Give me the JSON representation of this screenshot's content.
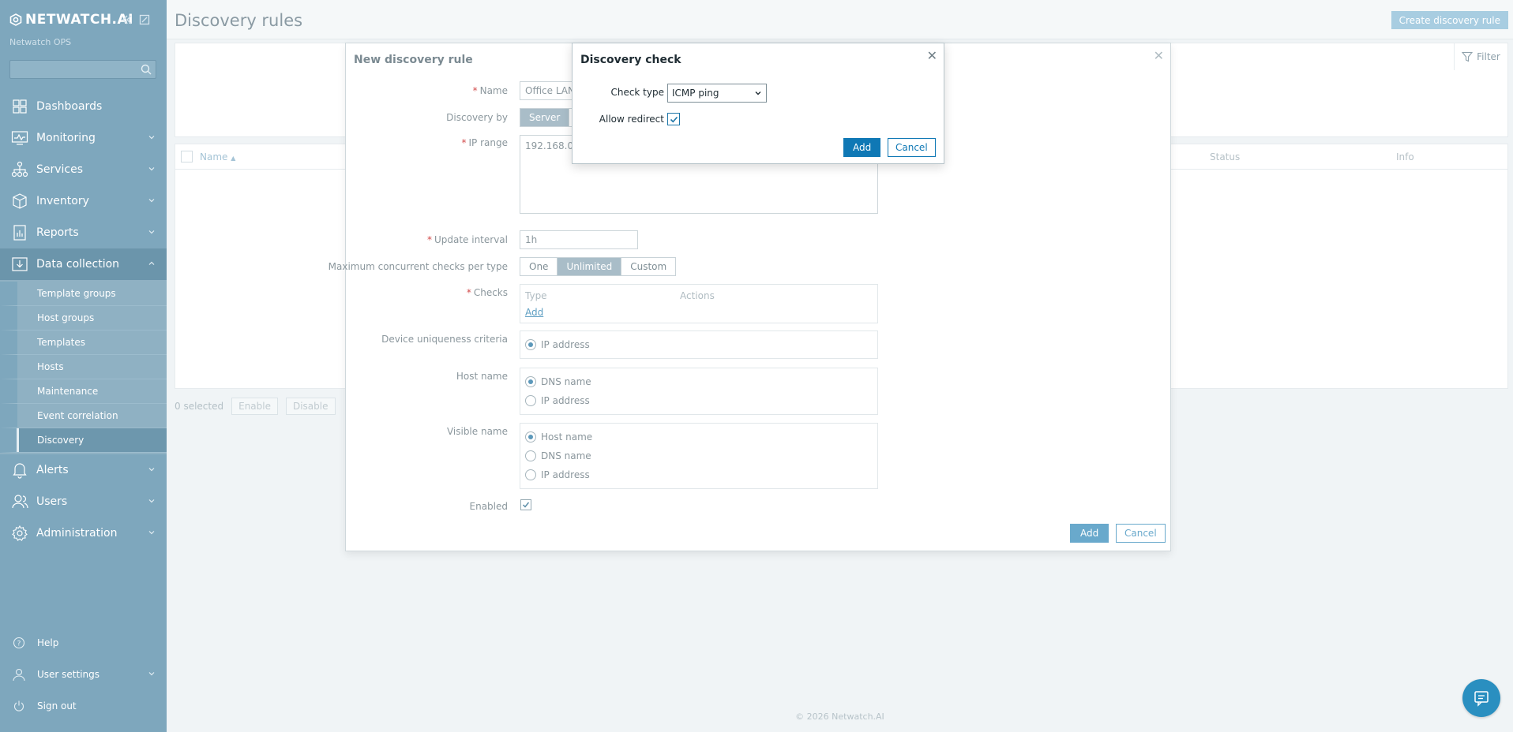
{
  "brand": {
    "logo": "NETWATCH.AI",
    "subtitle": "Netwatch OPS"
  },
  "sidebar": {
    "items": [
      {
        "label": "Dashboards"
      },
      {
        "label": "Monitoring"
      },
      {
        "label": "Services"
      },
      {
        "label": "Inventory"
      },
      {
        "label": "Reports"
      },
      {
        "label": "Data collection"
      },
      {
        "label": "Alerts"
      },
      {
        "label": "Users"
      },
      {
        "label": "Administration"
      }
    ],
    "data_collection_sub": [
      {
        "label": "Template groups"
      },
      {
        "label": "Host groups"
      },
      {
        "label": "Templates"
      },
      {
        "label": "Hosts"
      },
      {
        "label": "Maintenance"
      },
      {
        "label": "Event correlation"
      },
      {
        "label": "Discovery"
      }
    ],
    "bottom": [
      {
        "label": "Help"
      },
      {
        "label": "User settings"
      },
      {
        "label": "Sign out"
      }
    ]
  },
  "page": {
    "title": "Discovery rules",
    "create_button": "Create discovery rule",
    "filter_label": "Filter",
    "columns": {
      "name": "Name",
      "status": "Status",
      "info": "Info"
    },
    "selected_count": "0 selected",
    "enable_button": "Enable",
    "disable_button": "Disable",
    "footer": "© 2026 Netwatch.AI"
  },
  "rule_dialog": {
    "title": "New discovery rule",
    "name_label": "Name",
    "name_value": "Office LAN",
    "discovery_by_label": "Discovery by",
    "discovery_by_value": "Server",
    "ip_range_label": "IP range",
    "ip_range_value": "192.168.0.1",
    "update_interval_label": "Update interval",
    "update_interval_value": "1h",
    "max_checks_label": "Maximum concurrent checks per type",
    "max_checks_options": [
      "One",
      "Unlimited",
      "Custom"
    ],
    "max_checks_selected": "Unlimited",
    "checks_label": "Checks",
    "checks_type_header": "Type",
    "checks_actions_header": "Actions",
    "checks_add_link": "Add",
    "uniqueness_label": "Device uniqueness criteria",
    "uniqueness_option": "IP address",
    "host_name_label": "Host name",
    "host_name_options": [
      "DNS name",
      "IP address"
    ],
    "visible_name_label": "Visible name",
    "visible_name_options": [
      "Host name",
      "DNS name",
      "IP address"
    ],
    "enabled_label": "Enabled",
    "add_button": "Add",
    "cancel_button": "Cancel"
  },
  "check_dialog": {
    "title": "Discovery check",
    "check_type_label": "Check type",
    "check_type_value": "ICMP ping",
    "allow_redirect_label": "Allow redirect",
    "allow_redirect_checked": true,
    "add_button": "Add",
    "cancel_button": "Cancel"
  },
  "colors": {
    "sidebar": "#7ea7bd",
    "primary": "#0f78b5",
    "accent": "#69a9cc"
  }
}
